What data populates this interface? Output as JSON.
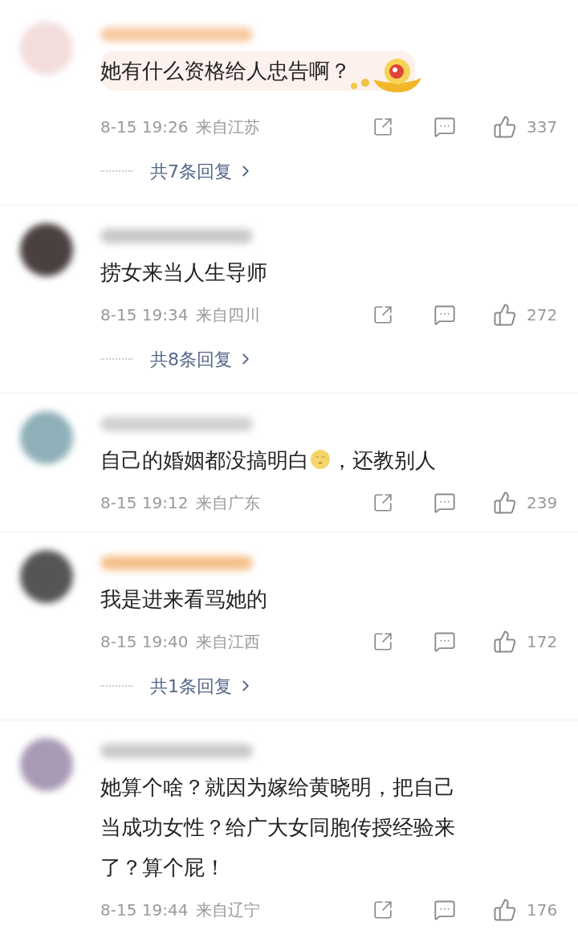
{
  "comments": [
    {
      "avatar": {
        "color": "#f3dcdc"
      },
      "name_blur": {
        "color": "#f7c9a0"
      },
      "decorated": true,
      "lines": [
        [
          {
            "kind": "text",
            "text": "她有什么资格给人忠告啊？"
          }
        ]
      ],
      "time": "8-15 19:26",
      "location": "来自江苏",
      "likes": "337",
      "replies": "共7条回复"
    },
    {
      "avatar": {
        "color": "#4a4040"
      },
      "name_blur": {
        "color": "#c8c8c8"
      },
      "decorated": false,
      "lines": [
        [
          {
            "kind": "text",
            "text": "捞女来当人生导师"
          }
        ]
      ],
      "time": "8-15 19:34",
      "location": "来自四川",
      "likes": "272",
      "replies": "共8条回复"
    },
    {
      "avatar": {
        "color": "#8fb0b8"
      },
      "name_blur": {
        "color": "#d0d0d0"
      },
      "decorated": false,
      "lines": [
        [
          {
            "kind": "text",
            "text": "自己的婚姻都没搞明白"
          },
          {
            "kind": "emoji"
          },
          {
            "kind": "text",
            "text": "，还教别人"
          }
        ]
      ],
      "time": "8-15 19:12",
      "location": "来自广东",
      "likes": "239"
    },
    {
      "avatar": {
        "color": "#555555"
      },
      "name_blur": {
        "color": "#f5c08a"
      },
      "decorated": false,
      "lines": [
        [
          {
            "kind": "text",
            "text": "我是进来看骂她的"
          }
        ]
      ],
      "time": "8-15 19:40",
      "location": "来自江西",
      "likes": "172",
      "replies": "共1条回复"
    },
    {
      "avatar": {
        "color": "#a99ab5"
      },
      "name_blur": {
        "color": "#c8c8c8"
      },
      "decorated": false,
      "lines": [
        [
          {
            "kind": "text",
            "text": "她算个啥？就因为嫁给黄晓明，把自己"
          }
        ],
        [
          {
            "kind": "text",
            "text": "当成功女性？给广大女同胞传授经验来"
          }
        ],
        [
          {
            "kind": "text",
            "text": "了？算个屁！"
          }
        ]
      ],
      "time": "8-15 19:44",
      "location": "来自辽宁",
      "likes": "176"
    }
  ]
}
